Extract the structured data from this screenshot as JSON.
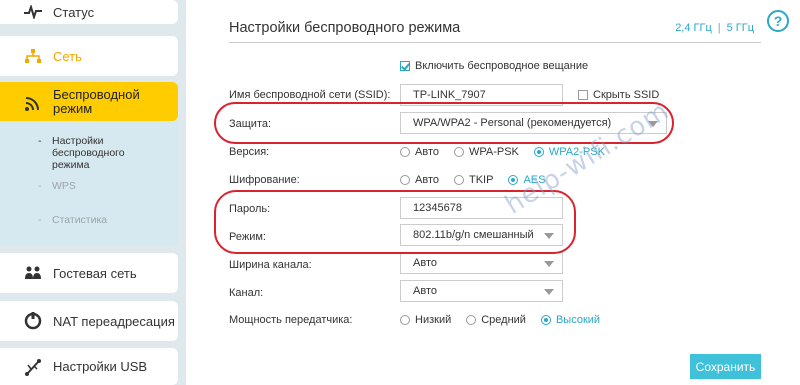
{
  "sidebar": {
    "items": [
      {
        "label": "Статус",
        "icon": "pulse-icon"
      },
      {
        "label": "Сеть",
        "icon": "network-icon"
      },
      {
        "label": "Беспроводной режим",
        "icon": "wifi-icon"
      },
      {
        "label": "Гостевая сеть",
        "icon": "guests-icon"
      },
      {
        "label": "NAT переадресация",
        "icon": "nat-icon"
      },
      {
        "label": "Настройки USB",
        "icon": "usb-icon"
      }
    ],
    "subitems": [
      {
        "label": "Настройки беспроводного режима"
      },
      {
        "label": "WPS"
      },
      {
        "label": "Статистика"
      }
    ]
  },
  "main": {
    "title": "Настройки беспроводного режима",
    "freq_24": "2,4 ГГц",
    "freq_sep": "|",
    "freq_5": "5 ГГц",
    "enable_broadcast": "Включить беспроводное вещание",
    "ssid_label": "Имя беспроводной сети (SSID):",
    "ssid_value": "TP-LINK_7907",
    "hide_ssid": "Скрыть SSID",
    "security_label": "Защита:",
    "security_value": "WPA/WPA2 - Personal (рекомендуется)",
    "version_label": "Версия:",
    "version_options": [
      "Авто",
      "WPA-PSK",
      "WPA2-PSK"
    ],
    "encryption_label": "Шифрование:",
    "encryption_options": [
      "Авто",
      "TKIP",
      "AES"
    ],
    "password_label": "Пароль:",
    "password_value": "12345678",
    "mode_label": "Режим:",
    "mode_value": "802.11b/g/n смешанный",
    "channel_width_label": "Ширина канала:",
    "channel_width_value": "Авто",
    "channel_label": "Канал:",
    "channel_value": "Авто",
    "tx_power_label": "Мощность передатчика:",
    "tx_power_options": [
      "Низкий",
      "Средний",
      "Высокий"
    ],
    "save_label": "Сохранить"
  },
  "watermark": "help-wifi.com",
  "colors": {
    "accent": "#2aa8c6",
    "active_nav": "#ffcc00",
    "highlight": "#d9232e",
    "save": "#3fc2d9"
  }
}
